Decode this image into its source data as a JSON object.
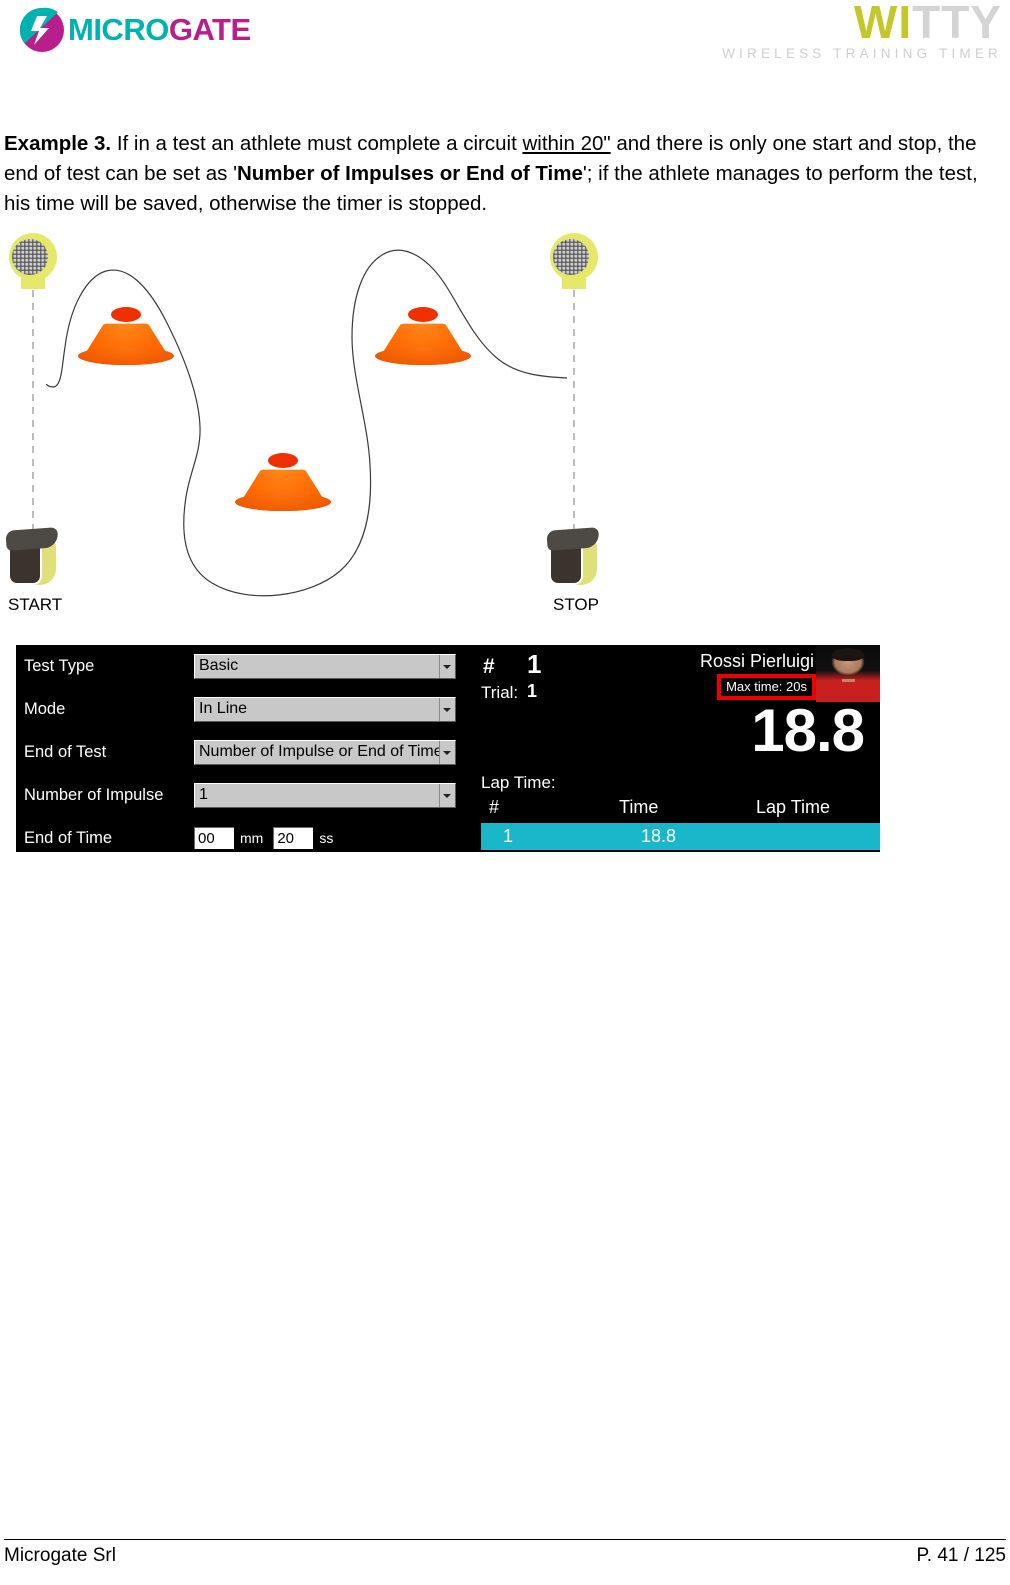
{
  "header": {
    "microgate_logo_text": "MICROGATE",
    "microgate_part1": "MICRO",
    "microgate_part2": "GATE",
    "witty_part1": "WI",
    "witty_part2": "TTY",
    "witty_tagline": "WIRELESS TRAINING TIMER",
    "colors": {
      "microgate_teal": "#00b3ae",
      "microgate_magenta": "#b81f8c",
      "witty_olive": "#c3c72a",
      "witty_grey": "#d4d4d4"
    }
  },
  "body": {
    "example_label": "Example 3.",
    "text_part1": " If in a test an athlete must complete a circuit ",
    "underlined": "within 20\"",
    "text_part2": " and there is only one start and stop, the end of test can be set as '",
    "bold_term": "Number of Impulses or End of Time",
    "text_part3": "'; if the athlete manages to perform the test, his time will be saved, otherwise the timer is stopped."
  },
  "diagram": {
    "start_label": "START",
    "stop_label": "STOP",
    "cone_count": 3,
    "photocell_top_count": 2,
    "photocell_bottom_count": 2
  },
  "witty_ui": {
    "settings": [
      {
        "label": "Test Type",
        "value": "Basic"
      },
      {
        "label": "Mode",
        "value": "In Line"
      },
      {
        "label": "End of Test",
        "value": "Number of Impulse or End of Time"
      },
      {
        "label": "Number of Impulse",
        "value": "1"
      }
    ],
    "end_of_time": {
      "label": "End of Time",
      "minutes": "00",
      "minutes_unit": "mm",
      "seconds": "20",
      "seconds_unit": "ss"
    },
    "results": {
      "index_hash": "#",
      "index_value": "1",
      "trial_label": "Trial:",
      "trial_value": "1",
      "athlete_name": "Rossi  Pierluigi",
      "max_time_badge": "Max time: 20s",
      "big_time": "18.8",
      "lap_time_caption": "Lap  Time:",
      "lap_columns": [
        "#",
        "Time",
        "Lap  Time"
      ],
      "lap_rows": [
        {
          "num": "1",
          "time": "18.8",
          "lap": ""
        }
      ],
      "highlight_color": "#19b7c9",
      "badge_border_color": "#ee0000"
    }
  },
  "footer": {
    "company": "Microgate Srl",
    "page": "P. 41 / 125"
  }
}
